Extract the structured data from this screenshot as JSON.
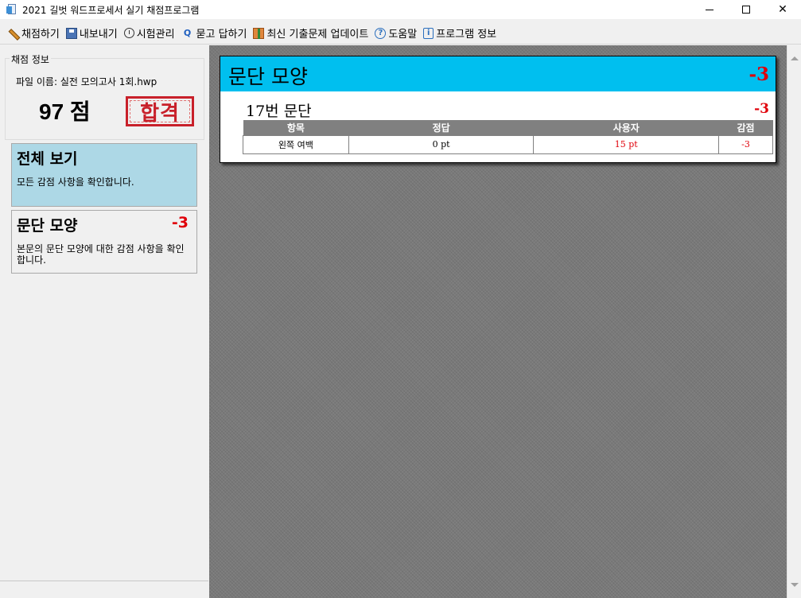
{
  "window": {
    "title": "2021 길벗 워드프로세서 실기 채점프로그램"
  },
  "menu": {
    "items": [
      {
        "label": "채점하기",
        "icon": "pencil-icon"
      },
      {
        "label": "내보내기",
        "icon": "save-icon"
      },
      {
        "label": "시험관리",
        "icon": "clock-icon"
      },
      {
        "label": "묻고 답하기",
        "icon": "qa-icon"
      },
      {
        "label": "최신 기출문제 업데이트",
        "icon": "gift-icon"
      },
      {
        "label": "도움말",
        "icon": "help-icon"
      },
      {
        "label": "프로그램 정보",
        "icon": "info-icon"
      }
    ]
  },
  "sidebar": {
    "group_label": "채점 정보",
    "file_line": "파일 이름: 실전 모의고사 1회.hwp",
    "score": "97 점",
    "result_stamp": "합격",
    "cards": [
      {
        "title": "전체 보기",
        "desc": "모든 감점 사항을 확인합니다.",
        "deduct": ""
      },
      {
        "title": "문단 모양",
        "desc": "본문의 문단 모양에 대한 감점 사항을 확인합니다.",
        "deduct": "-3"
      }
    ]
  },
  "main": {
    "panel_title": "문단 모양",
    "panel_deduct": "-3",
    "section_title": "17번 문단",
    "section_deduct": "-3",
    "table": {
      "headers": [
        "항목",
        "정답",
        "사용자",
        "감점"
      ],
      "rows": [
        [
          "왼쪽 여백",
          "0 pt",
          "15 pt",
          "-3"
        ]
      ]
    }
  },
  "colors": {
    "header_cyan": "#00bfef",
    "selected_card": "#add8e6",
    "deduct_red": "#e0000a",
    "stamp_red": "#c8202a"
  }
}
